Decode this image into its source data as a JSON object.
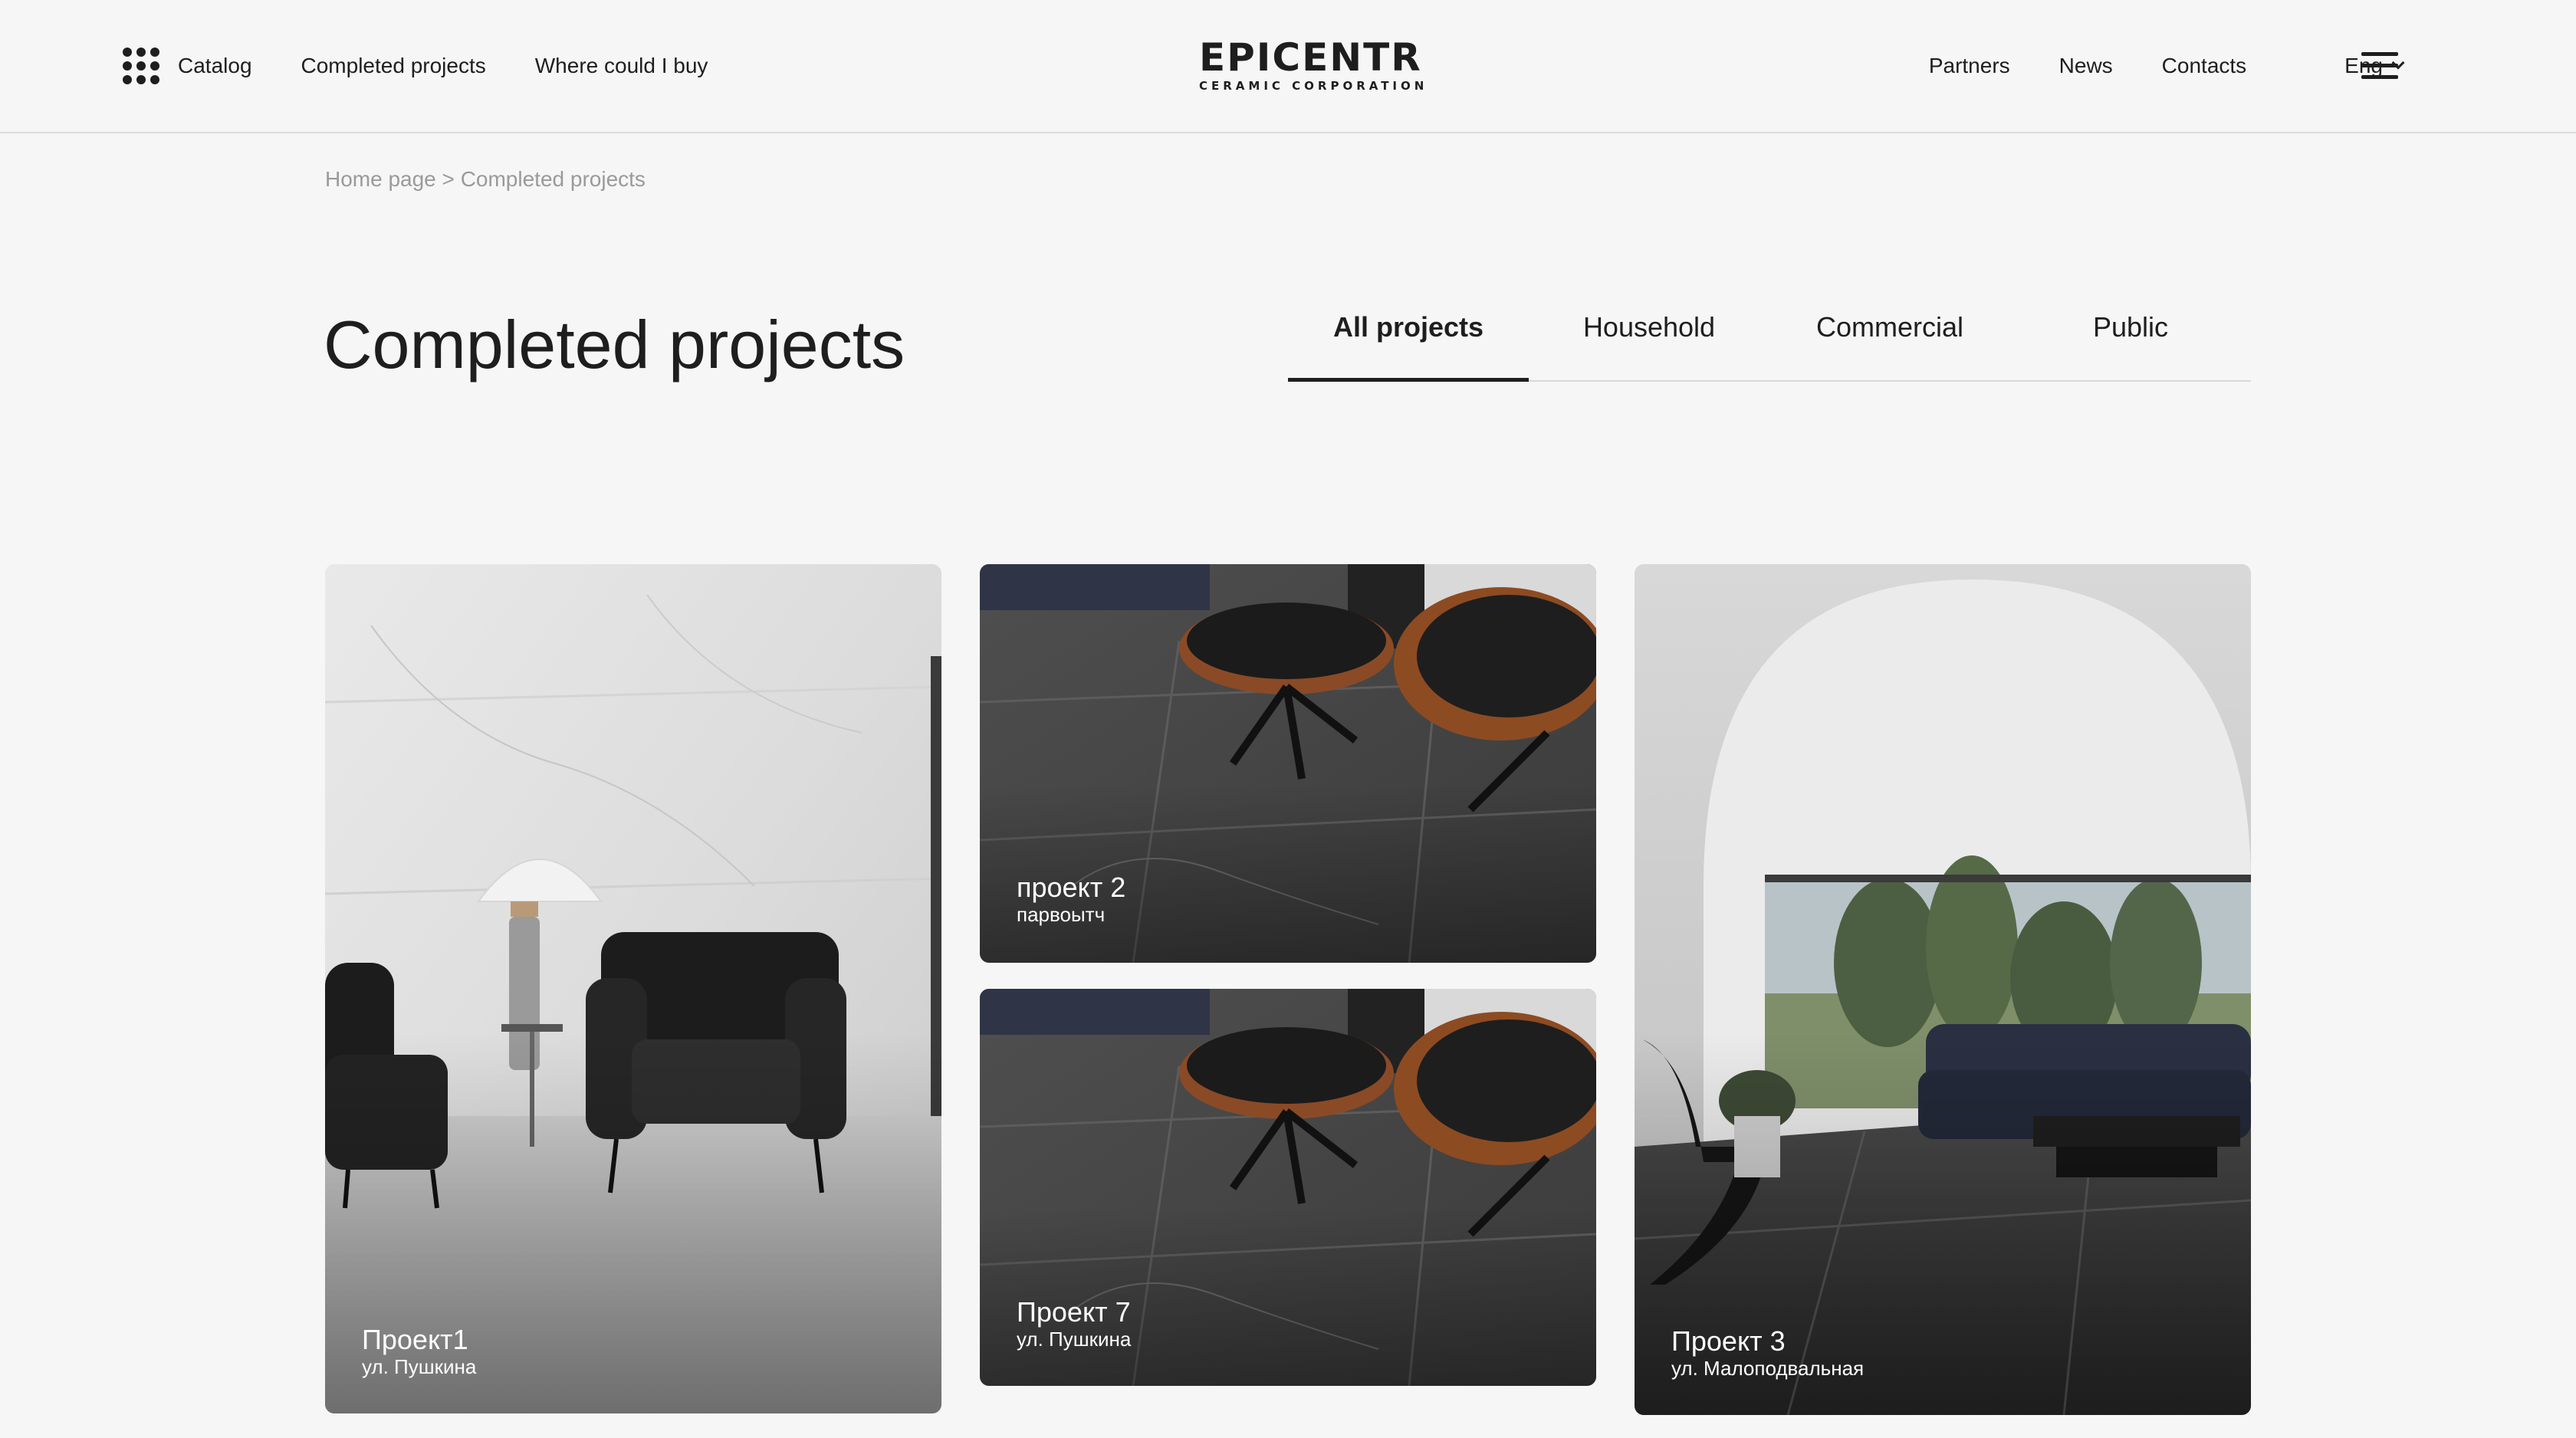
{
  "header": {
    "nav_left": [
      "Catalog",
      "Completed projects",
      "Where could I buy"
    ],
    "logo": {
      "main": "EPICENTR",
      "sub": "CERAMIC CORPORATION"
    },
    "nav_right": [
      "Partners",
      "News",
      "Contacts"
    ],
    "language": "Eng"
  },
  "breadcrumb": {
    "home": "Home page",
    "separator": " > ",
    "current": "Completed projects"
  },
  "page": {
    "title": "Completed projects"
  },
  "tabs": [
    "All projects",
    "Household",
    "Commercial",
    "Public"
  ],
  "active_tab": "All projects",
  "projects": [
    {
      "title": "Проект1",
      "subtitle": "ул. Пушкина",
      "scene": "white marble wall with black leather armchairs and lamp"
    },
    {
      "title": "проект 2",
      "subtitle": "парвоытч",
      "scene": "dark stone floor with black leather lounge chair"
    },
    {
      "title": "Проект 7",
      "subtitle": "ул. Пушкина",
      "scene": "dark stone floor with black leather lounge chair"
    },
    {
      "title": "Проект 3",
      "subtitle": "ул. Малоподвальная",
      "scene": "arched white room with dark floor, sofa and garden view"
    }
  ],
  "colors": {
    "background": "#f6f6f6",
    "text": "#1e1e1e",
    "breadcrumb": "#9a9a9a",
    "divider": "#d8d8d8"
  }
}
